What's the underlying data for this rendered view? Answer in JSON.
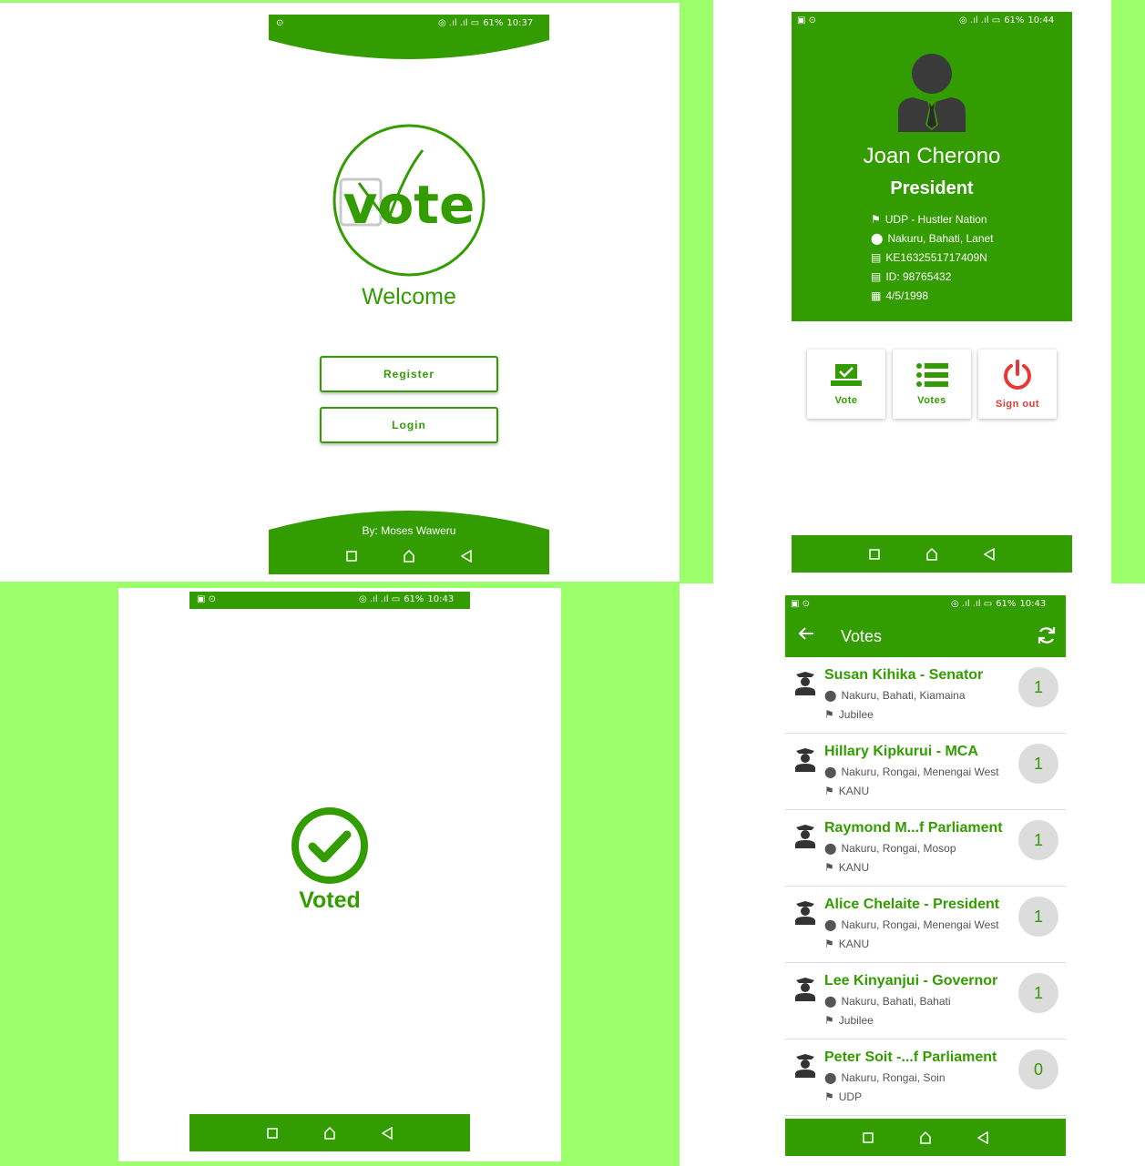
{
  "colors": {
    "brand_green": "#329c00",
    "background": "#9cff6c",
    "danger": "#e53935",
    "badge_grey": "#dcdcdc"
  },
  "welcome_screen": {
    "status": {
      "battery": "61%",
      "time": "10:37"
    },
    "logo_text": "vote",
    "title": "Welcome",
    "register_label": "Register",
    "login_label": "Login",
    "credit": "By: Moses Waweru"
  },
  "profile_screen": {
    "status": {
      "battery": "61%",
      "time": "10:44"
    },
    "name": "Joan Cherono",
    "position": "President",
    "party": "UDP - Hustler Nation",
    "location": "Nakuru, Bahati, Lanet",
    "voter_number": "KE1632551717409N",
    "id_number": "ID: 98765432",
    "dob": "4/5/1998",
    "actions": [
      {
        "label": "Vote",
        "icon": "ballot-box-icon"
      },
      {
        "label": "Votes",
        "icon": "list-icon"
      },
      {
        "label": "Sign out",
        "icon": "power-icon"
      }
    ]
  },
  "voted_screen": {
    "status": {
      "battery": "61%",
      "time": "10:43"
    },
    "message": "Voted"
  },
  "votes_screen": {
    "status": {
      "battery": "61%",
      "time": "10:43"
    },
    "title": "Votes",
    "candidates": [
      {
        "name": "Susan Kihika - Senator",
        "location": "Nakuru, Bahati, Kiamaina",
        "party": "Jubilee",
        "votes": "1"
      },
      {
        "name": "Hillary Kipkurui - MCA",
        "location": "Nakuru, Rongai, Menengai West",
        "party": "KANU",
        "votes": "1"
      },
      {
        "name": "Raymond M...f Parliament",
        "location": "Nakuru, Rongai, Mosop",
        "party": "KANU",
        "votes": "1"
      },
      {
        "name": "Alice Chelaite - President",
        "location": "Nakuru, Rongai, Menengai West",
        "party": "KANU",
        "votes": "1"
      },
      {
        "name": "Lee Kinyanjui - Governor",
        "location": "Nakuru, Bahati, Bahati",
        "party": "Jubilee",
        "votes": "1"
      },
      {
        "name": "Peter Soit -...f Parliament",
        "location": "Nakuru, Rongai, Soin",
        "party": "UDP",
        "votes": "0"
      }
    ]
  }
}
